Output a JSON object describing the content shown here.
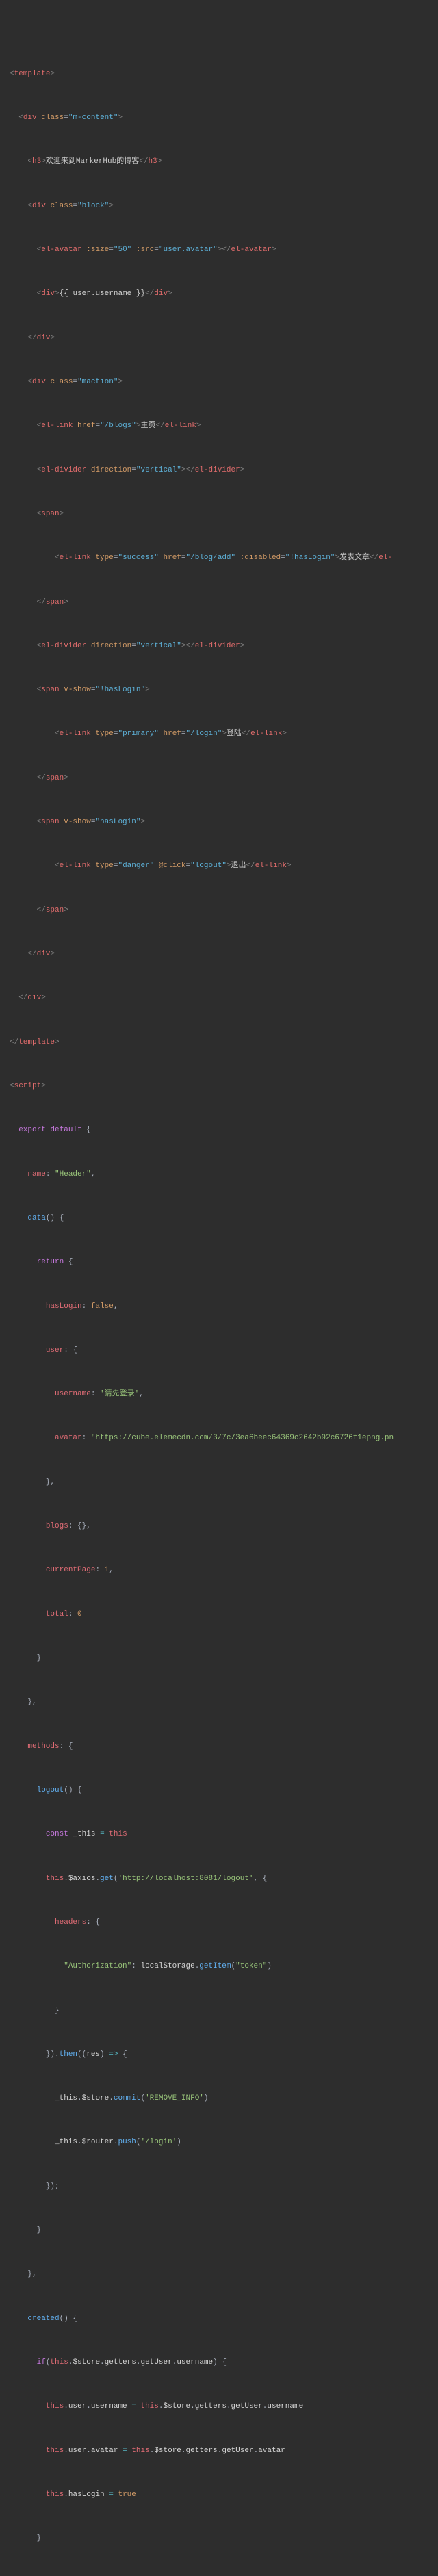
{
  "template": {
    "open": "<template>",
    "close": "</template>",
    "div_content_open": "<div class=\"m-content\">",
    "div_close": "</div>",
    "h3_open": "<h3>",
    "h3_text": "欢迎来到MarkerHub的博客",
    "h3_close": "</h3>",
    "block_open": "<div class=\"block\">",
    "avatar": "<el-avatar :size=\"50\" :src=\"user.avatar\"></el-avatar>",
    "username_div_open": "<div>",
    "username_mustache": "{{ user.username }}",
    "username_div_close": "</div>",
    "maction_open": "<div class=\"maction\">",
    "link_home_open": "<el-link href=\"/blogs\">",
    "link_home_text": "主页",
    "link_home_close": "</el-link>",
    "divider": "<el-divider direction=\"vertical\"></el-divider>",
    "span_open": "<span>",
    "span_close": "</span>",
    "link_add_open": "<el-link type=\"success\" href=\"/blog/add\" :disabled=\"!hasLogin\">",
    "link_add_text": "发表文章",
    "link_add_close": "</el-",
    "span_show_not_open": "<span v-show=\"!hasLogin\">",
    "link_login_open": "<el-link type=\"primary\" href=\"/login\">",
    "link_login_text": "登陆",
    "link_login_close": "</el-link>",
    "span_show_open": "<span v-show=\"hasLogin\">",
    "link_logout_open": "<el-link type=\"danger\" @click=\"logout\">",
    "link_logout_text": "退出",
    "link_logout_close": "</el-link>"
  },
  "script": {
    "open": "<script>",
    "export": "export default {",
    "name_key": "name:",
    "name_val": "\"Header\"",
    "data_fn": "data() {",
    "return": "return {",
    "hasLogin_key": "hasLogin:",
    "hasLogin_val": "false",
    "user_key": "user: {",
    "username_key": "username:",
    "username_val": "'请先登录'",
    "avatar_key": "avatar:",
    "avatar_val": "\"https://cube.elemecdn.com/3/7c/3ea6beec64369c2642b92c6726f1epng.pn",
    "user_close": "},",
    "blogs_key": "blogs:",
    "blogs_val": "{}",
    "currentPage_key": "currentPage:",
    "currentPage_val": "1",
    "total_key": "total:",
    "total_val": "0",
    "close_brace": "}",
    "close_brace_c": "},",
    "methods": "methods: {",
    "logout_fn": "logout() {",
    "const_this": "const _this = this",
    "axios_get": "this.$axios.get('http://localhost:8081/logout', {",
    "headers": "headers: {",
    "auth_key": "\"Authorization\"",
    "auth_val": "localStorage.getItem(\"token\")",
    "then": "}).then((res) => {",
    "store_commit": "_this.$store.commit('REMOVE_INFO')",
    "router_push": "_this.$router.push('/login')",
    "close_paren": "});",
    "created": "created() {",
    "if_line": "if(this.$store.getters.getUser.username) {",
    "set_user": "this.user.username = this.$store.getters.getUser.username",
    "set_avatar": "this.user.avatar = this.$store.getters.getUser.avatar",
    "set_login": "this.hasLogin = true"
  }
}
